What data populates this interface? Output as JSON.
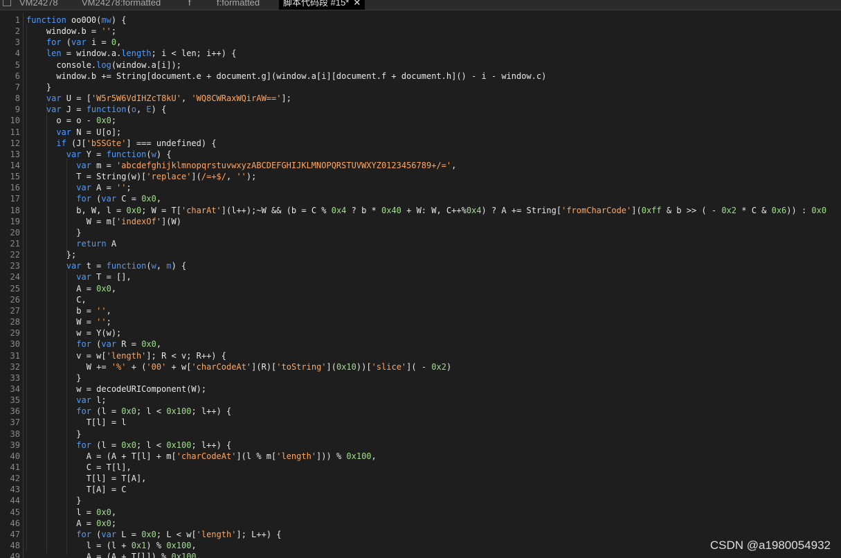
{
  "tabs": [
    {
      "label": "VM24278",
      "active": false
    },
    {
      "label": "VM24278:formatted",
      "active": false
    },
    {
      "label": "f",
      "active": false
    },
    {
      "label": "f:formatted",
      "active": false
    },
    {
      "label": "脚本代码段 #15*",
      "active": true
    }
  ],
  "watermark": "CSDN @a1980054932",
  "colors": {
    "background": "#1e1e1e",
    "keyword": "#4f9cff",
    "plain": "#e8e8e8",
    "string": "#ffa65e",
    "number": "#9ee08a",
    "param": "#5a8bd6",
    "line_number": "#8a8a8a"
  },
  "code_lines": [
    [
      [
        "k",
        "function"
      ],
      [
        "p",
        " oo0O0("
      ],
      [
        "v",
        "mw"
      ],
      [
        "p",
        ") {"
      ]
    ],
    [
      [
        "p",
        "    window.b = "
      ],
      [
        "s",
        "''"
      ],
      [
        "p",
        ";"
      ]
    ],
    [
      [
        "k",
        "    for"
      ],
      [
        "p",
        " ("
      ],
      [
        "k",
        "var"
      ],
      [
        "p",
        " i = "
      ],
      [
        "n",
        "0"
      ],
      [
        "p",
        ","
      ]
    ],
    [
      [
        "k",
        "    len"
      ],
      [
        "p",
        " = window.a."
      ],
      [
        "k",
        "length"
      ],
      [
        "p",
        "; i < len; i++) {"
      ]
    ],
    [
      [
        "p",
        "      console."
      ],
      [
        "k",
        "log"
      ],
      [
        "p",
        "(window.a[i]);"
      ]
    ],
    [
      [
        "p",
        "      window.b += String[document.e + document.g](window.a[i][document.f + document.h]() - i - window.c)"
      ]
    ],
    [
      [
        "p",
        "    }"
      ]
    ],
    [
      [
        "k",
        "    var"
      ],
      [
        "p",
        " U = ["
      ],
      [
        "s",
        "'W5r5W6VdIHZcT8kU'"
      ],
      [
        "p",
        ", "
      ],
      [
        "s",
        "'WQ8CWRaxWQirAW=='"
      ],
      [
        "p",
        "];"
      ]
    ],
    [
      [
        "k",
        "    var"
      ],
      [
        "p",
        " J = "
      ],
      [
        "k",
        "function"
      ],
      [
        "p",
        "("
      ],
      [
        "v",
        "o"
      ],
      [
        "p",
        ", "
      ],
      [
        "v",
        "E"
      ],
      [
        "p",
        ") {"
      ]
    ],
    [
      [
        "p",
        "      o = o - "
      ],
      [
        "n",
        "0x0"
      ],
      [
        "p",
        ";"
      ]
    ],
    [
      [
        "k",
        "      var"
      ],
      [
        "p",
        " N = U[o];"
      ]
    ],
    [
      [
        "k",
        "      if"
      ],
      [
        "p",
        " (J["
      ],
      [
        "s",
        "'bSSGte'"
      ],
      [
        "p",
        "] === undefined) {"
      ]
    ],
    [
      [
        "k",
        "        var"
      ],
      [
        "p",
        " Y = "
      ],
      [
        "k",
        "function"
      ],
      [
        "p",
        "("
      ],
      [
        "v",
        "w"
      ],
      [
        "p",
        ") {"
      ]
    ],
    [
      [
        "k",
        "          var"
      ],
      [
        "p",
        " m = "
      ],
      [
        "s",
        "'abcdefghijklmnopqrstuvwxyzABCDEFGHIJKLMNOPQRSTUVWXYZ0123456789+/='"
      ],
      [
        "p",
        ","
      ]
    ],
    [
      [
        "p",
        "          T = String(w)["
      ],
      [
        "s",
        "'replace'"
      ],
      [
        "p",
        "]("
      ],
      [
        "s",
        "/=+$/"
      ],
      [
        "p",
        ", "
      ],
      [
        "s",
        "''"
      ],
      [
        "p",
        ");"
      ]
    ],
    [
      [
        "k",
        "          var"
      ],
      [
        "p",
        " A = "
      ],
      [
        "s",
        "''"
      ],
      [
        "p",
        ";"
      ]
    ],
    [
      [
        "k",
        "          for"
      ],
      [
        "p",
        " ("
      ],
      [
        "k",
        "var"
      ],
      [
        "p",
        " C = "
      ],
      [
        "n",
        "0x0"
      ],
      [
        "p",
        ","
      ]
    ],
    [
      [
        "p",
        "          b, W, l = "
      ],
      [
        "n",
        "0x0"
      ],
      [
        "p",
        "; W = T["
      ],
      [
        "s",
        "'charAt'"
      ],
      [
        "p",
        "](l++);~W && (b = C % "
      ],
      [
        "n",
        "0x4"
      ],
      [
        "p",
        " ? b * "
      ],
      [
        "n",
        "0x40"
      ],
      [
        "p",
        " + W: W, C++%"
      ],
      [
        "n",
        "0x4"
      ],
      [
        "p",
        ") ? A += String["
      ],
      [
        "s",
        "'fromCharCode'"
      ],
      [
        "p",
        "]("
      ],
      [
        "n",
        "0xff"
      ],
      [
        "p",
        " & b >> ( - "
      ],
      [
        "n",
        "0x2"
      ],
      [
        "p",
        " * C & "
      ],
      [
        "n",
        "0x6"
      ],
      [
        "p",
        ")) : "
      ],
      [
        "n",
        "0x0"
      ]
    ],
    [
      [
        "p",
        "            W = m["
      ],
      [
        "s",
        "'indexOf'"
      ],
      [
        "p",
        "](W)"
      ]
    ],
    [
      [
        "p",
        "          }"
      ]
    ],
    [
      [
        "k",
        "          return"
      ],
      [
        "p",
        " A"
      ]
    ],
    [
      [
        "p",
        "        };"
      ]
    ],
    [
      [
        "k",
        "        var"
      ],
      [
        "p",
        " t = "
      ],
      [
        "k",
        "function"
      ],
      [
        "p",
        "("
      ],
      [
        "v",
        "w"
      ],
      [
        "p",
        ", "
      ],
      [
        "v",
        "m"
      ],
      [
        "p",
        ") {"
      ]
    ],
    [
      [
        "k",
        "          var"
      ],
      [
        "p",
        " T = [],"
      ]
    ],
    [
      [
        "p",
        "          A = "
      ],
      [
        "n",
        "0x0"
      ],
      [
        "p",
        ","
      ]
    ],
    [
      [
        "p",
        "          C,"
      ]
    ],
    [
      [
        "p",
        "          b = "
      ],
      [
        "s",
        "''"
      ],
      [
        "p",
        ","
      ]
    ],
    [
      [
        "p",
        "          W = "
      ],
      [
        "s",
        "''"
      ],
      [
        "p",
        ";"
      ]
    ],
    [
      [
        "p",
        "          w = Y(w);"
      ]
    ],
    [
      [
        "k",
        "          for"
      ],
      [
        "p",
        " ("
      ],
      [
        "k",
        "var"
      ],
      [
        "p",
        " R = "
      ],
      [
        "n",
        "0x0"
      ],
      [
        "p",
        ","
      ]
    ],
    [
      [
        "p",
        "          v = w["
      ],
      [
        "s",
        "'length'"
      ],
      [
        "p",
        "]; R < v; R++) {"
      ]
    ],
    [
      [
        "p",
        "            W += "
      ],
      [
        "s",
        "'%'"
      ],
      [
        "p",
        " + ("
      ],
      [
        "s",
        "'00'"
      ],
      [
        "p",
        " + w["
      ],
      [
        "s",
        "'charCodeAt'"
      ],
      [
        "p",
        "](R)["
      ],
      [
        "s",
        "'toString'"
      ],
      [
        "p",
        "]("
      ],
      [
        "n",
        "0x10"
      ],
      [
        "p",
        "))["
      ],
      [
        "s",
        "'slice'"
      ],
      [
        "p",
        "]( - "
      ],
      [
        "n",
        "0x2"
      ],
      [
        "p",
        ")"
      ]
    ],
    [
      [
        "p",
        "          }"
      ]
    ],
    [
      [
        "p",
        "          w = decodeURIComponent(W);"
      ]
    ],
    [
      [
        "k",
        "          var"
      ],
      [
        "p",
        " l;"
      ]
    ],
    [
      [
        "k",
        "          for"
      ],
      [
        "p",
        " (l = "
      ],
      [
        "n",
        "0x0"
      ],
      [
        "p",
        "; l < "
      ],
      [
        "n",
        "0x100"
      ],
      [
        "p",
        "; l++) {"
      ]
    ],
    [
      [
        "p",
        "            T[l] = l"
      ]
    ],
    [
      [
        "p",
        "          }"
      ]
    ],
    [
      [
        "k",
        "          for"
      ],
      [
        "p",
        " (l = "
      ],
      [
        "n",
        "0x0"
      ],
      [
        "p",
        "; l < "
      ],
      [
        "n",
        "0x100"
      ],
      [
        "p",
        "; l++) {"
      ]
    ],
    [
      [
        "p",
        "            A = (A + T[l] + m["
      ],
      [
        "s",
        "'charCodeAt'"
      ],
      [
        "p",
        "](l % m["
      ],
      [
        "s",
        "'length'"
      ],
      [
        "p",
        "])) % "
      ],
      [
        "n",
        "0x100"
      ],
      [
        "p",
        ","
      ]
    ],
    [
      [
        "p",
        "            C = T[l],"
      ]
    ],
    [
      [
        "p",
        "            T[l] = T[A],"
      ]
    ],
    [
      [
        "p",
        "            T[A] = C"
      ]
    ],
    [
      [
        "p",
        "          }"
      ]
    ],
    [
      [
        "p",
        "          l = "
      ],
      [
        "n",
        "0x0"
      ],
      [
        "p",
        ","
      ]
    ],
    [
      [
        "p",
        "          A = "
      ],
      [
        "n",
        "0x0"
      ],
      [
        "p",
        ";"
      ]
    ],
    [
      [
        "k",
        "          for"
      ],
      [
        "p",
        " ("
      ],
      [
        "k",
        "var"
      ],
      [
        "p",
        " L = "
      ],
      [
        "n",
        "0x0"
      ],
      [
        "p",
        "; L < w["
      ],
      [
        "s",
        "'length'"
      ],
      [
        "p",
        "]; L++) {"
      ]
    ],
    [
      [
        "p",
        "            l = (l + "
      ],
      [
        "n",
        "0x1"
      ],
      [
        "p",
        ") % "
      ],
      [
        "n",
        "0x100"
      ],
      [
        "p",
        ","
      ]
    ],
    [
      [
        "p",
        "            A = (A + T[l]) % "
      ],
      [
        "n",
        "0x100"
      ],
      [
        "p",
        ","
      ]
    ]
  ]
}
